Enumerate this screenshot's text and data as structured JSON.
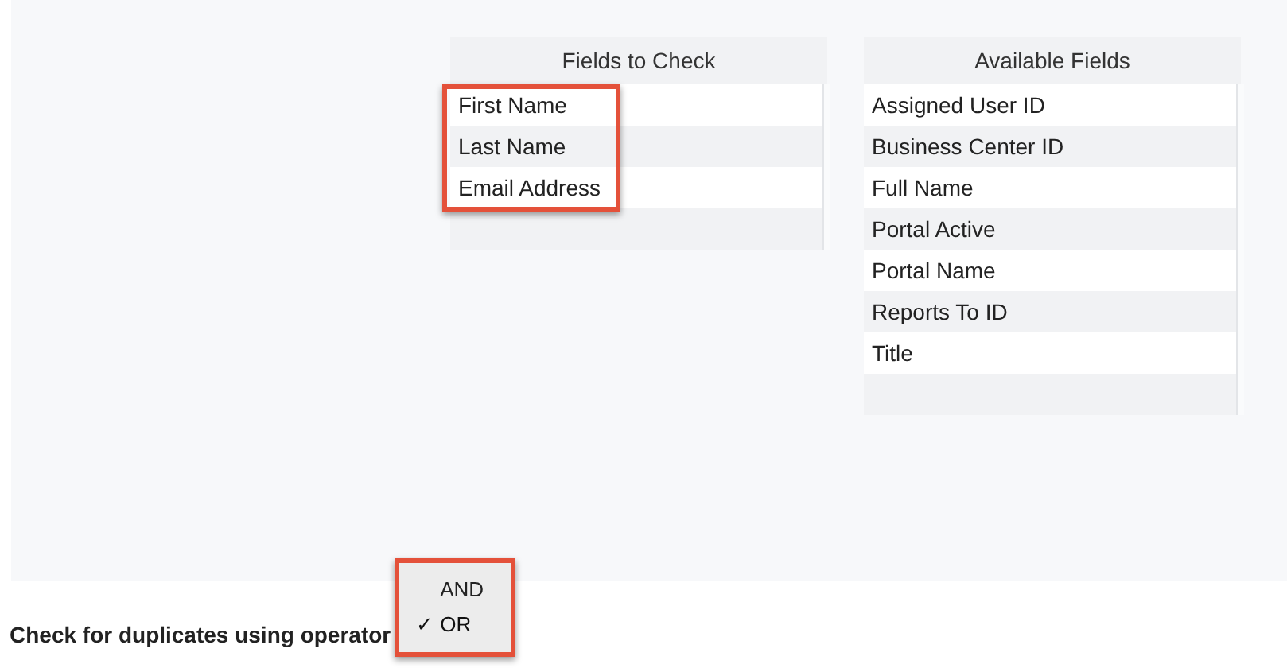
{
  "fields_to_check": {
    "title": "Fields to Check",
    "items": [
      "First Name",
      "Last Name",
      "Email Address"
    ]
  },
  "available_fields": {
    "title": "Available Fields",
    "items": [
      "Assigned User ID",
      "Business Center ID",
      "Full Name",
      "Portal Active",
      "Portal Name",
      "Reports To ID",
      "Title"
    ]
  },
  "operator": {
    "label": "Check for duplicates using operator",
    "options": [
      {
        "label": "AND",
        "selected": false
      },
      {
        "label": "OR",
        "selected": true
      }
    ],
    "check_mark": "✓"
  }
}
